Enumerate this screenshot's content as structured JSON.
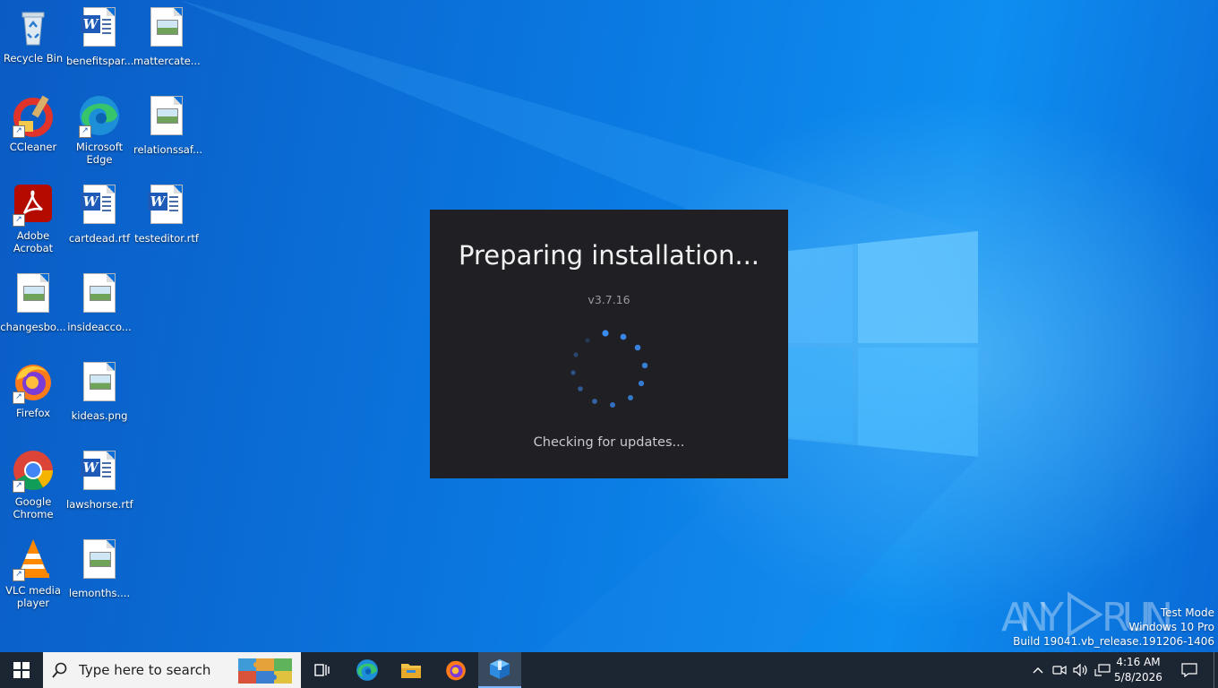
{
  "desktop": {
    "icons": [
      {
        "label": "Recycle Bin"
      },
      {
        "label": "benefitspar..."
      },
      {
        "label": "mattercate..."
      },
      {
        "label": "CCleaner"
      },
      {
        "label": "Microsoft Edge"
      },
      {
        "label": "relationssaf..."
      },
      {
        "label": "Adobe Acrobat"
      },
      {
        "label": "cartdead.rtf"
      },
      {
        "label": "testeditor.rtf"
      },
      {
        "label": "changesbo..."
      },
      {
        "label": "insideacco..."
      },
      {
        "label": "Firefox"
      },
      {
        "label": "kideas.png"
      },
      {
        "label": "Google Chrome"
      },
      {
        "label": "lawshorse.rtf"
      },
      {
        "label": "VLC media player"
      },
      {
        "label": "lemonths...."
      }
    ]
  },
  "installer": {
    "title": "Preparing installation...",
    "version": "v3.7.16",
    "status": "Checking for updates..."
  },
  "watermark": {
    "logo_text": "ANY RUN",
    "line1": "Test Mode",
    "line2": "Windows 10 Pro",
    "line3": "Build 19041.vb_release.191206-1406"
  },
  "taskbar": {
    "search_placeholder": "Type here to search",
    "apps": [
      "task-view-icon",
      "edge-icon",
      "file-explorer-icon",
      "firefox-icon",
      "installer-icon"
    ],
    "clock": {
      "time": "4:16 AM",
      "date": "5/8/2026"
    }
  },
  "colors": {
    "desktop_blue": "#0a6fd8",
    "dialog_bg": "#1f1f24",
    "spinner_blue": "#3b8cf0",
    "taskbar": "#1c2532"
  }
}
